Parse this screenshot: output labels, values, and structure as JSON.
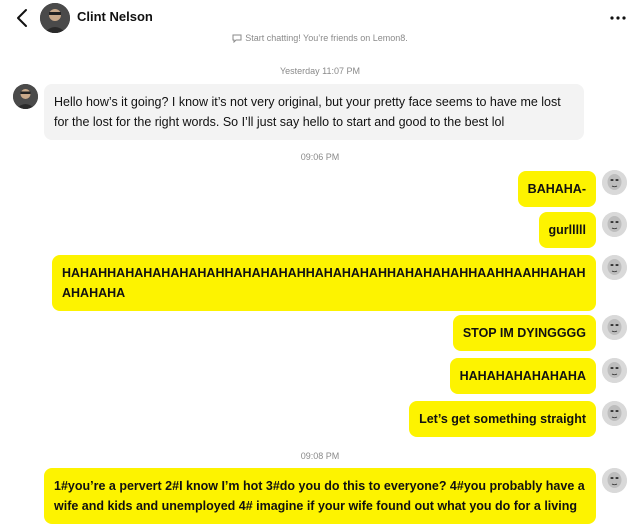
{
  "header": {
    "contact_name": "Clint Nelson"
  },
  "system_notice": "Start chatting! You’re friends on Lemon8.",
  "timestamps": {
    "first": "Yesterday 11:07 PM",
    "second": "09:06 PM",
    "third": "09:08 PM"
  },
  "messages": [
    {
      "from": "friend",
      "text": "Hello how’s it going? I know it’s not very original, but your pretty face seems to have me lost for the lost for the right words. So I’ll just say hello to start and good to the best lol"
    },
    {
      "from": "me",
      "text": "BAHAHA-"
    },
    {
      "from": "me",
      "text": "gurlllll"
    },
    {
      "from": "me",
      "text": "HAHAHHAHAHAHAHAHAHHAHAHAHAHHAHAHAHAHHAHAHAHAHHAAHHAAHHAHAHAHAHAHA"
    },
    {
      "from": "me",
      "text": "STOP IM DYINGGGG"
    },
    {
      "from": "me",
      "text": "HAHAHAHAHAHAHA"
    },
    {
      "from": "me",
      "text": "Let’s get something straight"
    },
    {
      "from": "me",
      "text": "1#you’re a pervert 2#I know I’m hot 3#do you do this to everyone? 4#you probably have a wife and kids and unemployed 4# imagine if your wife found out what you do for a living"
    }
  ],
  "colors": {
    "outgoing_bubble": "#fdf300",
    "incoming_bubble": "#f3f3f3",
    "meta_text": "#8a8a8a"
  },
  "icons": {
    "back": "chevron-left-icon",
    "more": "more-horizontal-icon",
    "notice": "chat-bubble-icon"
  }
}
